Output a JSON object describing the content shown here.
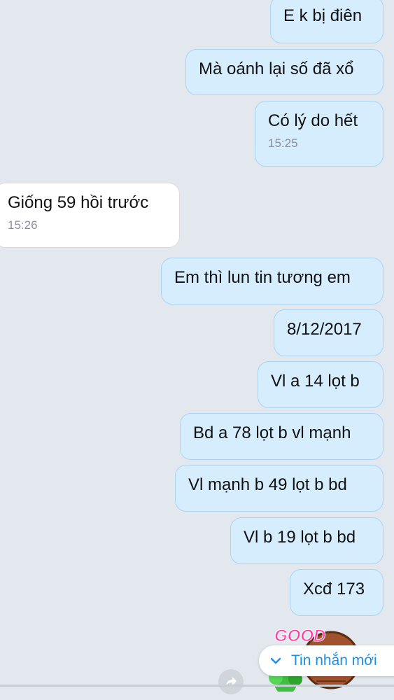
{
  "messages": [
    {
      "text": "E k bị điên"
    },
    {
      "text": "Mà oánh lại số đã xổ"
    },
    {
      "text": "Có lý do hết",
      "time": "15:25"
    },
    {
      "text": "Giống 59 hồi trước",
      "time": "15:26"
    },
    {
      "text": "Em thì lun tin tương em"
    },
    {
      "text": "8/12/2017"
    },
    {
      "text": "Vl a 14 lọt b"
    },
    {
      "text": "Bd a 78 lọt b vl mạnh"
    },
    {
      "text": "Vl mạnh b 49 lọt b bd"
    },
    {
      "text": "Vl b 19 lọt b bd"
    },
    {
      "text": "Xcđ 173"
    }
  ],
  "sticker": {
    "text": "GOOD"
  },
  "new_message_button": {
    "label": "Tin nhắn mới",
    "icon": "chevron-down-icon"
  },
  "share_button": {
    "icon": "share-arrow-icon"
  },
  "colors": {
    "background": "#e3e8ef",
    "outgoing_bubble": "#d6edfd",
    "incoming_bubble": "#ffffff",
    "accent": "#1a8ff0"
  }
}
